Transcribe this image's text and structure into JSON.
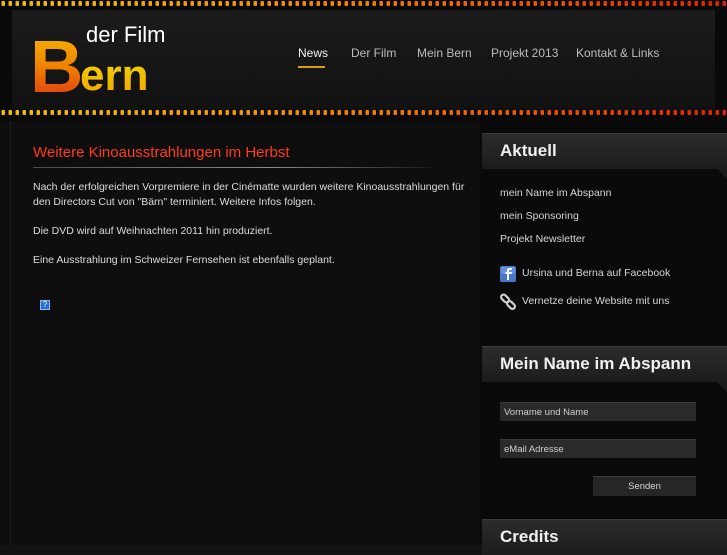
{
  "logo": {
    "small_text": "der Film",
    "big_text": "Bern"
  },
  "nav": {
    "items": [
      {
        "label": "News",
        "active": true
      },
      {
        "label": "Der Film",
        "active": false
      },
      {
        "label": "Mein Bern",
        "active": false
      },
      {
        "label": "Projekt 2013",
        "active": false
      },
      {
        "label": "Kontakt & Links",
        "active": false
      }
    ],
    "active_color": "#d8a000"
  },
  "article": {
    "title": "Weitere Kinoausstrahlungen im Herbst",
    "paragraphs": [
      "Nach der erfolgreichen Vorpremiere in der Cinématte wurden weitere Kinoausstrahlungen für den Directors Cut von \"Bärn\" terminiert. Weitere Infos folgen.",
      "Die DVD wird auf Weihnachten 2011 hin produziert.",
      "Eine Ausstrahlung im Schweizer Fernsehen ist ebenfalls geplant."
    ],
    "broken_image_glyph": "?",
    "title_color": "#ff3a1a"
  },
  "sidebar": {
    "aktuell": {
      "heading": "Aktuell",
      "links": [
        "mein Name im Abspann",
        "mein Sponsoring",
        "Projekt Newsletter"
      ],
      "facebook_label": "Ursina und Berna auf Facebook",
      "network_label": "Vernetze deine Website mit uns"
    },
    "abspann": {
      "heading": "Mein Name im Abspann",
      "name_value": "Vorname und Name",
      "email_value": "eMail Adresse",
      "submit_label": "Senden"
    },
    "credits": {
      "heading": "Credits"
    }
  },
  "icons": {
    "facebook": "facebook-icon",
    "link": "chain-link-icon"
  }
}
